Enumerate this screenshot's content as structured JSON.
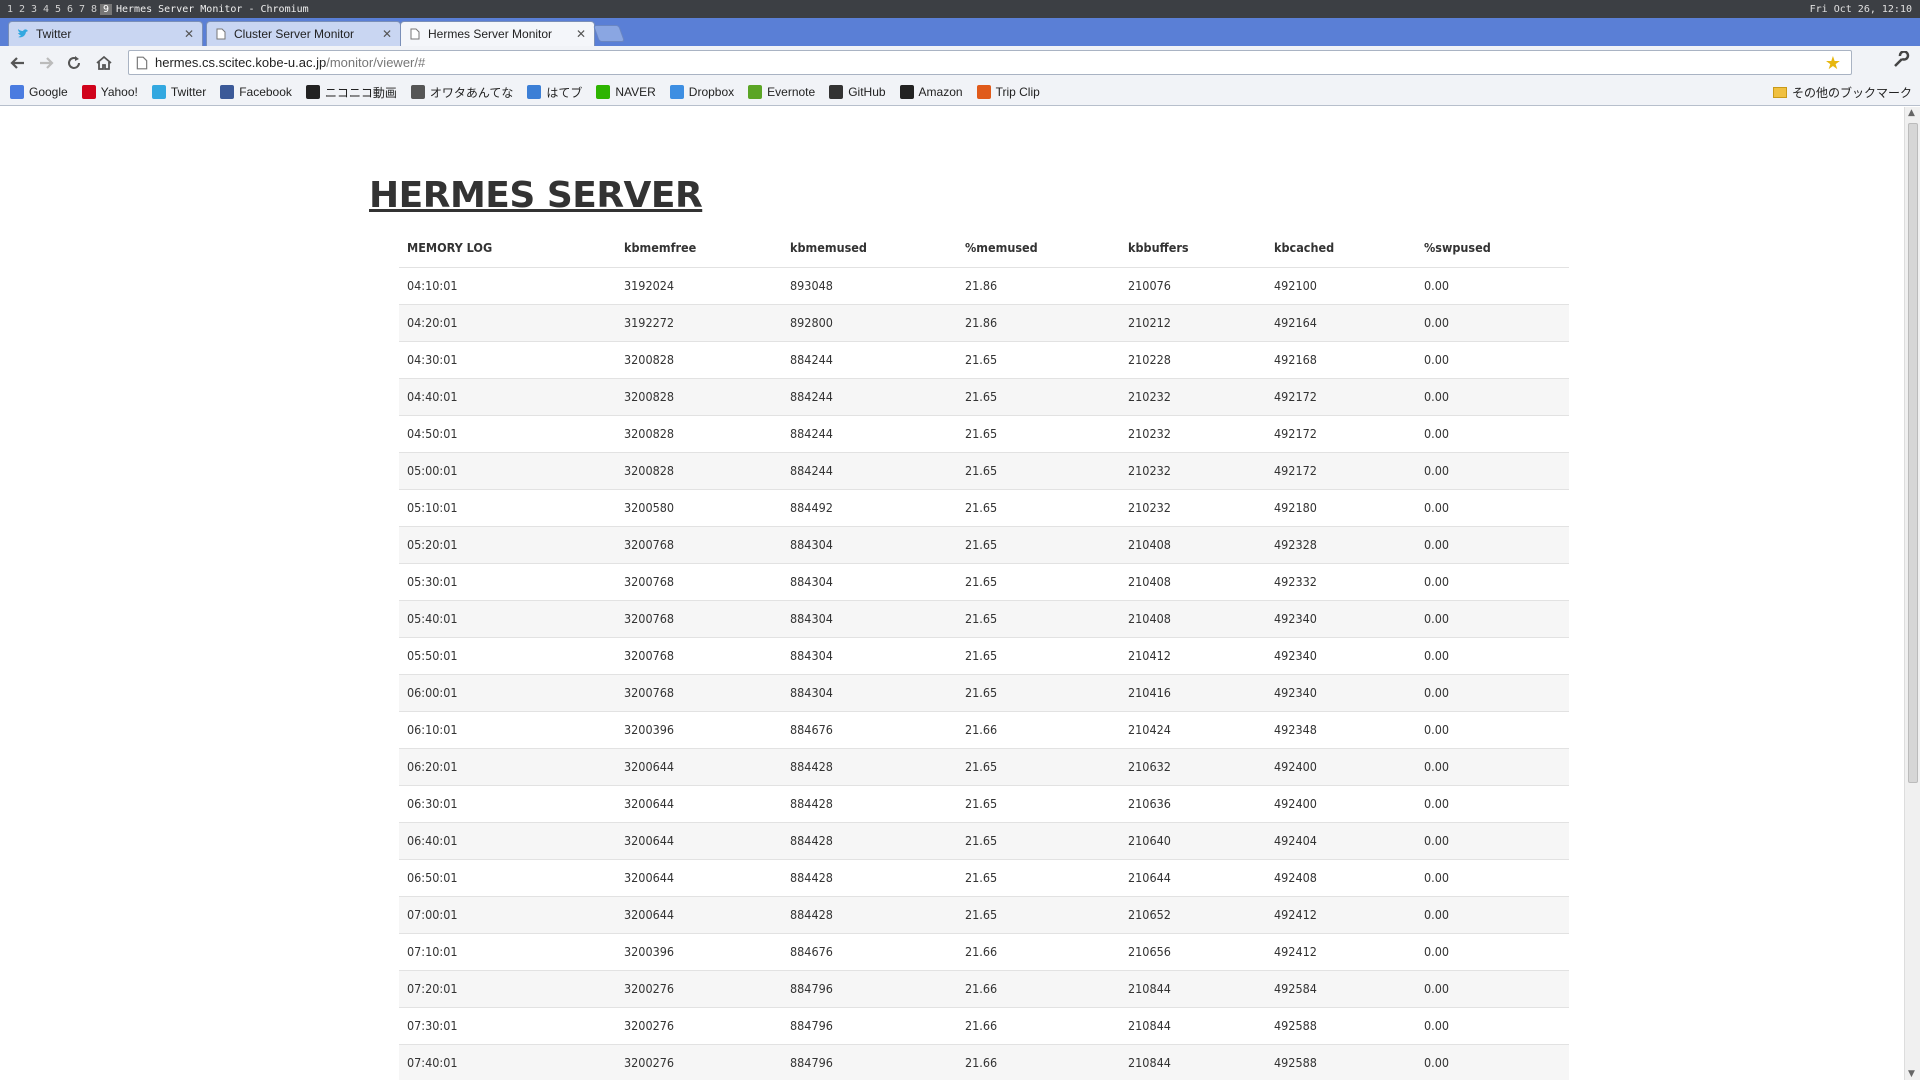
{
  "system": {
    "workspaces": [
      "1",
      "2",
      "3",
      "4",
      "5",
      "6",
      "7",
      "8",
      "9"
    ],
    "active_workspace": "9",
    "window_title": "Hermes Server Monitor - Chromium",
    "clock": "Fri Oct 26, 12:10"
  },
  "tabs": [
    {
      "label": "Twitter",
      "icon": "twitter-icon"
    },
    {
      "label": "Cluster Server Monitor",
      "icon": "page-icon"
    },
    {
      "label": "Hermes Server Monitor",
      "icon": "page-icon",
      "active": true
    }
  ],
  "toolbar": {
    "url_host": "hermes.cs.scitec.kobe-u.ac.jp",
    "url_path": "/monitor/viewer/#"
  },
  "bookmarks": [
    {
      "label": "Google",
      "icon": "google-icon",
      "color": "#4a7be0"
    },
    {
      "label": "Yahoo!",
      "icon": "yahoo-icon",
      "color": "#d0021b"
    },
    {
      "label": "Twitter",
      "icon": "twitter-icon",
      "color": "#33a8e0"
    },
    {
      "label": "Facebook",
      "icon": "facebook-icon",
      "color": "#3b5998"
    },
    {
      "label": "ニコニコ動画",
      "icon": "niconico-icon",
      "color": "#222222"
    },
    {
      "label": "オワタあんてな",
      "icon": "owata-icon",
      "color": "#555555"
    },
    {
      "label": "はてブ",
      "icon": "hatebu-icon",
      "color": "#3c7fd6"
    },
    {
      "label": "NAVER",
      "icon": "naver-icon",
      "color": "#2db400"
    },
    {
      "label": "Dropbox",
      "icon": "dropbox-icon",
      "color": "#3d8ee2"
    },
    {
      "label": "Evernote",
      "icon": "evernote-icon",
      "color": "#5ba525"
    },
    {
      "label": "GitHub",
      "icon": "github-icon",
      "color": "#333333"
    },
    {
      "label": "Amazon",
      "icon": "amazon-icon",
      "color": "#222222"
    },
    {
      "label": "Trip Clip",
      "icon": "tripclip-icon",
      "color": "#e05a1a"
    }
  ],
  "other_bookmarks": "その他のブックマーク",
  "page": {
    "title": "HERMES SERVER",
    "columns": [
      "MEMORY LOG",
      "kbmemfree",
      "kbmemused",
      "%memused",
      "kbbuffers",
      "kbcached",
      "%swpused"
    ],
    "rows": [
      [
        "04:10:01",
        "3192024",
        "893048",
        "21.86",
        "210076",
        "492100",
        "0.00"
      ],
      [
        "04:20:01",
        "3192272",
        "892800",
        "21.86",
        "210212",
        "492164",
        "0.00"
      ],
      [
        "04:30:01",
        "3200828",
        "884244",
        "21.65",
        "210228",
        "492168",
        "0.00"
      ],
      [
        "04:40:01",
        "3200828",
        "884244",
        "21.65",
        "210232",
        "492172",
        "0.00"
      ],
      [
        "04:50:01",
        "3200828",
        "884244",
        "21.65",
        "210232",
        "492172",
        "0.00"
      ],
      [
        "05:00:01",
        "3200828",
        "884244",
        "21.65",
        "210232",
        "492172",
        "0.00"
      ],
      [
        "05:10:01",
        "3200580",
        "884492",
        "21.65",
        "210232",
        "492180",
        "0.00"
      ],
      [
        "05:20:01",
        "3200768",
        "884304",
        "21.65",
        "210408",
        "492328",
        "0.00"
      ],
      [
        "05:30:01",
        "3200768",
        "884304",
        "21.65",
        "210408",
        "492332",
        "0.00"
      ],
      [
        "05:40:01",
        "3200768",
        "884304",
        "21.65",
        "210408",
        "492340",
        "0.00"
      ],
      [
        "05:50:01",
        "3200768",
        "884304",
        "21.65",
        "210412",
        "492340",
        "0.00"
      ],
      [
        "06:00:01",
        "3200768",
        "884304",
        "21.65",
        "210416",
        "492340",
        "0.00"
      ],
      [
        "06:10:01",
        "3200396",
        "884676",
        "21.66",
        "210424",
        "492348",
        "0.00"
      ],
      [
        "06:20:01",
        "3200644",
        "884428",
        "21.65",
        "210632",
        "492400",
        "0.00"
      ],
      [
        "06:30:01",
        "3200644",
        "884428",
        "21.65",
        "210636",
        "492400",
        "0.00"
      ],
      [
        "06:40:01",
        "3200644",
        "884428",
        "21.65",
        "210640",
        "492404",
        "0.00"
      ],
      [
        "06:50:01",
        "3200644",
        "884428",
        "21.65",
        "210644",
        "492408",
        "0.00"
      ],
      [
        "07:00:01",
        "3200644",
        "884428",
        "21.65",
        "210652",
        "492412",
        "0.00"
      ],
      [
        "07:10:01",
        "3200396",
        "884676",
        "21.66",
        "210656",
        "492412",
        "0.00"
      ],
      [
        "07:20:01",
        "3200276",
        "884796",
        "21.66",
        "210844",
        "492584",
        "0.00"
      ],
      [
        "07:30:01",
        "3200276",
        "884796",
        "21.66",
        "210844",
        "492588",
        "0.00"
      ],
      [
        "07:40:01",
        "3200276",
        "884796",
        "21.66",
        "210844",
        "492588",
        "0.00"
      ]
    ]
  }
}
